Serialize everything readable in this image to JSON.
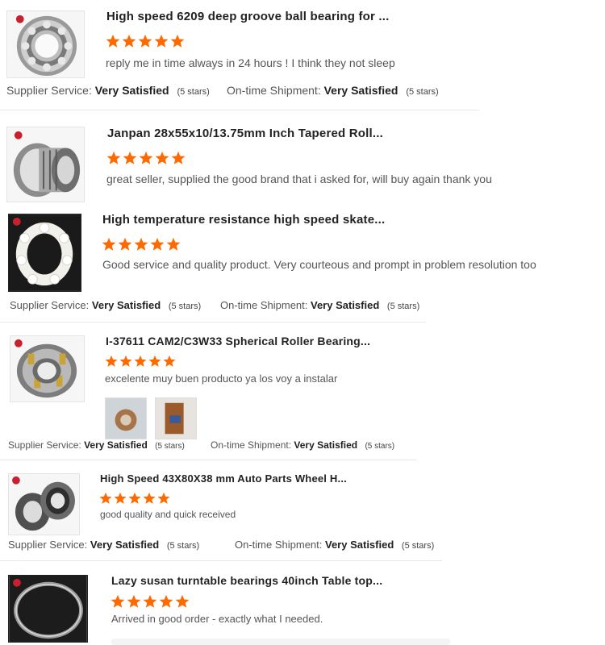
{
  "reviews": [
    {
      "title": "High speed 6209 deep groove ball bearing for ...",
      "rating": 5,
      "comment": "reply me in time always in 24 hours ! I think they not sleep",
      "supplier_label": "Supplier Service:",
      "supplier_value": "Very Satisfied",
      "supplier_stars": "(5 stars)",
      "shipment_label": "On-time Shipment:",
      "shipment_value": "Very Satisfied",
      "shipment_stars": "(5 stars)"
    },
    {
      "title": "Janpan 28x55x10/13.75mm Inch Tapered Roll...",
      "rating": 5,
      "comment": "great seller, supplied the good brand that i asked for, will buy again thank you"
    },
    {
      "title": "High temperature resistance high speed skate...",
      "rating": 5,
      "comment": "Good service and quality product. Very courteous and prompt in problem resolution too",
      "supplier_label": "Supplier Service:",
      "supplier_value": "Very Satisfied",
      "supplier_stars": "(5 stars)",
      "shipment_label": "On-time Shipment:",
      "shipment_value": "Very Satisfied",
      "shipment_stars": "(5 stars)"
    },
    {
      "title": "I-37611 CAM2/C3W33 Spherical Roller Bearing...",
      "rating": 5,
      "comment": "excelente muy buen producto ya los voy a instalar",
      "supplier_label": "Supplier Service:",
      "supplier_value": "Very Satisfied",
      "supplier_stars": "(5 stars)",
      "shipment_label": "On-time Shipment:",
      "shipment_value": "Very Satisfied",
      "shipment_stars": "(5 stars)"
    },
    {
      "title": "High Speed 43X80X38 mm Auto Parts Wheel H...",
      "rating": 5,
      "comment": "good quality and quick received",
      "supplier_label": "Supplier Service:",
      "supplier_value": "Very Satisfied",
      "supplier_stars": "(5 stars)",
      "shipment_label": "On-time Shipment:",
      "shipment_value": "Very Satisfied",
      "shipment_stars": "(5 stars)"
    },
    {
      "title": "Lazy susan turntable bearings 40inch Table top...",
      "rating": 5,
      "comment": "Arrived in good order - exactly what I needed."
    }
  ],
  "colors": {
    "star": "#ff6a00",
    "title": "#222222",
    "text": "#555555",
    "divider": "#e6e6e6"
  },
  "icons": {
    "star": "star-icon",
    "product": "bearing-image",
    "photo": "review-photo"
  }
}
